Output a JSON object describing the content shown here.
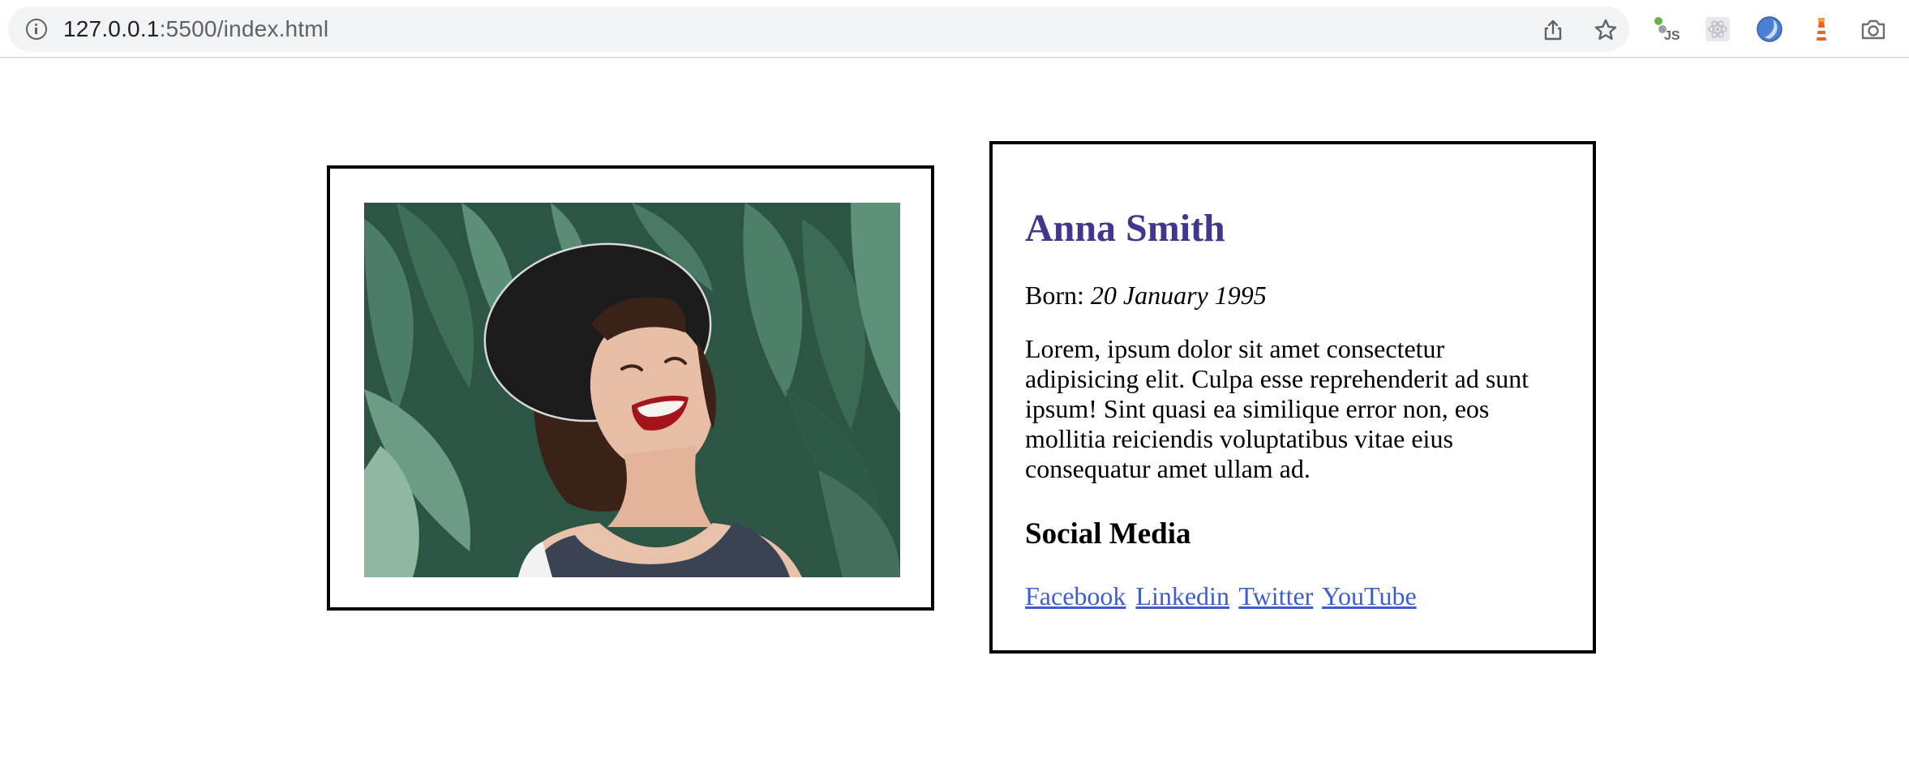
{
  "browser": {
    "url_host": "127.0.0.1",
    "url_rest": ":5500/index.html",
    "icons": [
      "info-icon",
      "share-icon",
      "bookmark-star-icon",
      "js-extension-icon",
      "react-extension-icon",
      "blue-extension-icon",
      "lighthouse-extension-icon",
      "camera-extension-icon"
    ]
  },
  "profile": {
    "name": "Anna Smith",
    "born_label": "Born: ",
    "born_date": "20 January 1995",
    "bio": "Lorem, ipsum dolor sit amet consectetur adipisicing elit. Culpa esse reprehenderit ad sunt ipsum! Sint quasi ea similique error non, eos mollitia reiciendis voluptatibus vitae eius consequatur amet ullam ad.",
    "social_title": "Social Media",
    "links": [
      "Facebook",
      "Linkedin",
      "Twitter",
      "YouTube"
    ]
  },
  "colors": {
    "name": "#40378f",
    "link": "#3d5ed1",
    "border": "#000000"
  }
}
